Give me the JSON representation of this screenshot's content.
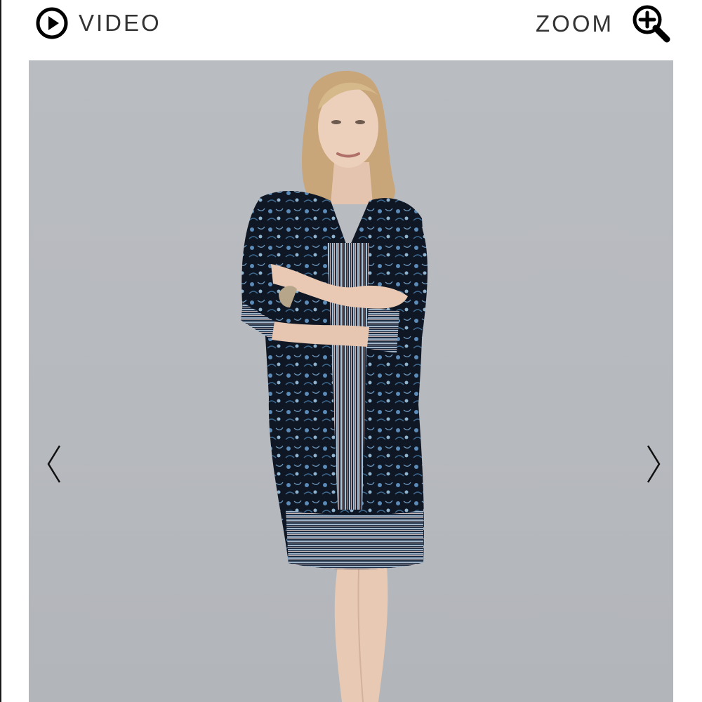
{
  "toolbar": {
    "video_label": "VIDEO",
    "video_icon": "play-circle-icon",
    "zoom_label": "ZOOM",
    "zoom_icon": "zoom-in-icon"
  },
  "gallery": {
    "prev_icon": "chevron-left-icon",
    "next_icon": "chevron-right-icon",
    "image_description_hidden": ""
  },
  "colors": {
    "text": "#333333",
    "icon": "#000000",
    "photo_background": "#b8bbc0",
    "dress_base": "#0f1624",
    "dress_accent": "#4b7aa6"
  }
}
